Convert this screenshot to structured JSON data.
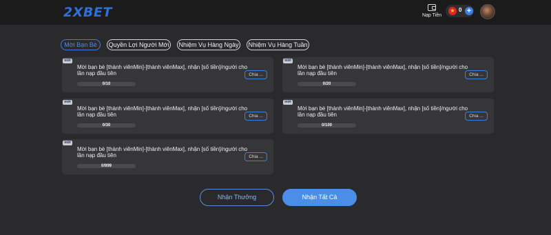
{
  "header": {
    "logo_text": "2XBET",
    "deposit_label": "Nạp Tiền",
    "deposit_icon": "wallet-icon",
    "balance": "0",
    "flag_icon": "vietnam-flag-icon",
    "flag_glyph": "★",
    "add_glyph": "+",
    "avatar_icon": "user-avatar"
  },
  "tabs": [
    {
      "label": "Mời Bạn Bè",
      "active": true
    },
    {
      "label": "Quyền Lợi Người Mới",
      "active": false
    },
    {
      "label": "Nhiệm Vụ Hàng Ngày",
      "active": false
    },
    {
      "label": "Nhiệm Vụ Hàng Tuần",
      "active": false
    }
  ],
  "cards": [
    {
      "badge": "mời",
      "text": "Mời bạn bè [thành viênMin]-[thành viênMax], nhận [số tiền]/người cho lần nạp đầu tiên",
      "progress": "0/10",
      "progress_fraction": 0,
      "share_label": "Chia ..."
    },
    {
      "badge": "mời",
      "text": "Mời bạn bè [thành viênMin]-[thành viênMax], nhận [số tiền]/người cho lần nạp đầu tiên",
      "progress": "0/20",
      "progress_fraction": 0,
      "share_label": "Chia ..."
    },
    {
      "badge": "mời",
      "text": "Mời bạn bè [thành viênMin]-[thành viênMax], nhận [số tiền]/người cho lần nạp đầu tiên",
      "progress": "0/30",
      "progress_fraction": 0,
      "share_label": "Chia ..."
    },
    {
      "badge": "mời",
      "text": "Mời bạn bè [thành viênMin]-[thành viênMax], nhận [số tiền]/người cho lần nạp đầu tiên",
      "progress": "0/100",
      "progress_fraction": 0,
      "share_label": "Chia ..."
    },
    {
      "badge": "mời",
      "text": "Mời bạn bè [thành viênMin]-[thành viênMax], nhận [số tiền]/người cho lần nạp đầu tiên",
      "progress": "0/999",
      "progress_fraction": 0,
      "share_label": "Chia ..."
    }
  ],
  "actions": {
    "claim_label": "Nhận Thưởng",
    "claim_all_label": "Nhận Tất Cả"
  },
  "colors": {
    "accent": "#3f7fe0",
    "background": "#2a2a2c",
    "card": "#363638"
  }
}
